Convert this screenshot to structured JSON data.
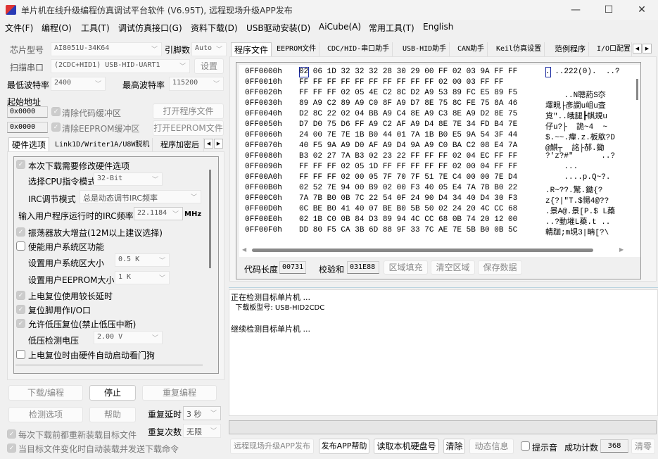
{
  "window": {
    "title": "单片机在线升级编程仿真调试平台软件 (V6.95T), 远程现场升级APP发布",
    "minimize": "—",
    "maximize": "☐",
    "close": "✕"
  },
  "menu": [
    "文件(F)",
    "编程(O)",
    "工具(T)",
    "调试仿真接口(G)",
    "资料下载(D)",
    "USB驱动安装(D)",
    "AiCube(A)",
    "常用工具(T)",
    "English"
  ],
  "left": {
    "chip_label": "芯片型号",
    "chip_value": "AI8051U-34K64",
    "pins_label": "引脚数",
    "pins_value": "Auto",
    "port_label": "扫描串口",
    "port_value": "(2CDC+HID1) USB-HID-UART1",
    "settings_btn": "设置",
    "min_baud_label": "最低波特率",
    "min_baud_value": "2400",
    "max_baud_label": "最高波特率",
    "max_baud_value": "115200",
    "start_addr_label": "起始地址",
    "addr1": "0x0000",
    "addr2": "0x0000",
    "clear_code": "清除代码缓冲区",
    "clear_eeprom": "清除EEPROM缓冲区",
    "open_prog": "打开程序文件",
    "open_eeprom": "打开EEPROM文件",
    "tabs": [
      "硬件选项",
      "Link1D/Writer1A/U8W脱机",
      "程序加密后"
    ],
    "hw": {
      "modify": "本次下载需要修改硬件选项",
      "cpu_mode_label": "选择CPU指令模式",
      "cpu_mode_value": "32-Bit",
      "irc_mode_label": "IRC调节模式",
      "irc_mode_value": "总是动态调节IRC频率",
      "irc_freq_label": "输入用户程序运行时的IRC频率",
      "irc_freq_value": "22.1184",
      "irc_unit": "MHz",
      "osc_gain": "振荡器放大增益(12M以上建议选择)",
      "user_sys": "使能用户系统区功能",
      "user_sys_size_label": "设置用户系统区大小",
      "user_sys_size_value": "0.5 K",
      "user_eeprom_label": "设置用户EEPROM大小",
      "user_eeprom_value": "1   K",
      "long_delay": "上电复位使用较长延时",
      "reset_io": "复位脚用作I/O口",
      "lvr": "允许低压复位(禁止低压中断)",
      "lvd_label": "低压检测电压",
      "lvd_value": "2.00 V",
      "watchdog": "上电复位时由硬件自动启动看门狗"
    },
    "download": "下载/编程",
    "stop": "停止",
    "repeat_prog": "重复编程",
    "detect": "检测选项",
    "help": "帮助",
    "repeat_delay_label": "重复延时",
    "repeat_delay_value": "3 秒",
    "repeat_count_label": "重复次数",
    "repeat_count_value": "无限",
    "reload": "每次下载前都重新装载目标文件",
    "auto_send": "当目标文件变化时自动装载并发送下载命令"
  },
  "right": {
    "tabs": [
      "程序文件",
      "EEPROM文件",
      "CDC/HID-串口助手",
      "USB-HID助手",
      "CAN助手",
      "Keil仿真设置",
      "范例程序",
      "I/O口配置"
    ],
    "hex": [
      [
        "0FF0000h",
        "02 06 1D 32 32 32 28 30 29 00 FF 02 03 9A FF FF",
        ". ..222(0).  ..?"
      ],
      [
        "0FF0010h",
        "FF FF FF FF FF FF FF FF FF FF 02 00 03 FF FF",
        ""
      ],
      [
        "0FF0020h",
        "FF FF FF 02 05 4E C2 8C D2 A9 53 89 FC E5 89 F5",
        "    ..N聰葯S夵"
      ],
      [
        "0FF0030h",
        "89 A9 C2 89 A9 C0 8F A9 D7 8E 75 8C FE 75 8A 46",
        "墿晛├彥譋u岨u査"
      ],
      [
        "0FF0040h",
        "D2 8C 22 02 04 BB A9 C4 8E A9 C3 8E A9 D2 8E 75",
        "覍\"..皒腿┣帺規u"
      ],
      [
        "0FF0050h",
        "D7 D0 75 D6 FF A9 C2 AF A9 D4 8E 7E 34 FD B4 7E",
        "仔u?├  詭~4  ~"
      ],
      [
        "0FF0060h",
        "24 00 7E 7E 1B B0 44 01 7A 1B B0 E5 9A 54 3F 44",
        "$.~~.癉.z.板歍?D"
      ],
      [
        "0FF0070h",
        "40 F5 9A A9 D0 AF A9 D4 9A A9 C0 BA C2 08 E4 7A",
        "@鯕┬  詺├郝.鋤"
      ],
      [
        "0FF0080h",
        "B3 02 27 7A B3 02 23 22 FF FF FF 02 04 EC FF FF",
        "?'z?#\"      ..?"
      ],
      [
        "0FF0090h",
        "FF FF FF 02 05 1D FF FF FF FF FF 02 00 04 FF FF",
        "    ..."
      ],
      [
        "0FF00A0h",
        "FF FF FF 02 00 05 7F 70 7F 51 7E C4 00 00 7E D4",
        "    ....p.Q~?."
      ],
      [
        "0FF00B0h",
        "02 52 7E 94 00 B9 02 00 F3 40 05 E4 7A 7B B0 22",
        ".R~??.驚.鋤{?"
      ],
      [
        "0FF00C0h",
        "7A 7B B0 0B 7C 22 54 0F 24 90 D4 34 40 D4 30 F3",
        "z{?|\"T.$愓4@??"
      ],
      [
        "0FF00D0h",
        "0C BE B0 41 40 07 BE B0 5B 50 02 24 20 4C CC 68",
        ".景A@.景[P.$ L蘃"
      ],
      [
        "0FF00E0h",
        "02 1B C0 0B 84 D3 89 94 4C CC 68 0B 74 20 12 00",
        "..?動墔L蘃.t .."
      ],
      [
        "0FF00F0h",
        "DD 80 F5 CA 3B 6D 88 9F 33 7C AE 7E 5B B0 0B 5C",
        "輤跏;m垷3|畘[?\\"
      ]
    ],
    "code_len_label": "代码长度",
    "code_len": "00731",
    "checksum_label": "校验和",
    "checksum": "031E88",
    "fill": "区域填充",
    "clear_area": "清空区域",
    "save": "保存数据",
    "log": [
      "正在检测目标单片机 ...",
      "  下载板型号: USB-HID2CDC",
      "",
      "继续检测目标单片机 ..."
    ],
    "progress": 0,
    "publish": "远程现场升级APP发布",
    "publish_help": "发布APP帮助",
    "read_disk": "读取本机硬盘号",
    "clear": "清除",
    "dyn_info": "动态信息",
    "beep": "提示音",
    "success_label": "成功计数",
    "success_count": "368",
    "reset_count": "清零"
  }
}
